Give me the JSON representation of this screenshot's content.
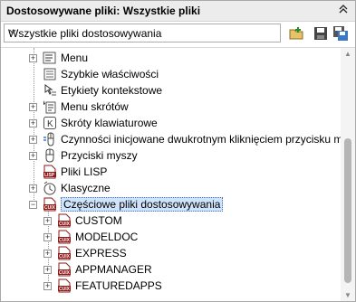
{
  "panel": {
    "title": "Dostosowywane pliki: Wszystkie pliki",
    "collapse_icon": "double-chevron-up-icon"
  },
  "toolbar": {
    "selector_value": "Wszystkie pliki dostosowywania",
    "buttons": [
      "open-file-icon",
      "save-icon",
      "save-as-icon"
    ]
  },
  "tree": {
    "items": [
      {
        "label": "Menu",
        "icon": "menu-icon",
        "expandable": true
      },
      {
        "label": "Szybkie właściwości",
        "icon": "quick-properties-icon",
        "expandable": false
      },
      {
        "label": "Etykiety kontekstowe",
        "icon": "rollover-tooltips-icon",
        "expandable": false
      },
      {
        "label": "Menu skrótów",
        "icon": "shortcut-menu-icon",
        "expandable": true
      },
      {
        "label": "Skróty klawiaturowe",
        "icon": "keyboard-shortcut-icon",
        "expandable": true
      },
      {
        "label": "Czynności inicjowane dwukrotnym kliknięciem przycisku myszy",
        "icon": "double-click-icon",
        "expandable": true
      },
      {
        "label": "Przyciski myszy",
        "icon": "mouse-buttons-icon",
        "expandable": true
      },
      {
        "label": "Pliki LISP",
        "icon": "lisp-file-icon",
        "expandable": false
      },
      {
        "label": "Klasyczne",
        "icon": "legacy-icon",
        "expandable": true
      },
      {
        "label": "Częściowe pliki dostosowywania",
        "icon": "cuix-file-icon",
        "expandable": true,
        "expanded": true,
        "selected": true
      }
    ],
    "partial_files": [
      {
        "label": "CUSTOM",
        "icon": "cuix-file-icon"
      },
      {
        "label": "MODELDOC",
        "icon": "cuix-file-icon"
      },
      {
        "label": "EXPRESS",
        "icon": "cuix-file-icon"
      },
      {
        "label": "APPMANAGER",
        "icon": "cuix-file-icon"
      },
      {
        "label": "FEATUREDAPPS",
        "icon": "cuix-file-icon"
      }
    ],
    "collapsed_sign": "+",
    "expanded_sign": "−"
  },
  "colors": {
    "selection_bg": "#cfe4fb",
    "selection_border": "#3a6fc4",
    "cuix_red": "#8b1a1a"
  }
}
